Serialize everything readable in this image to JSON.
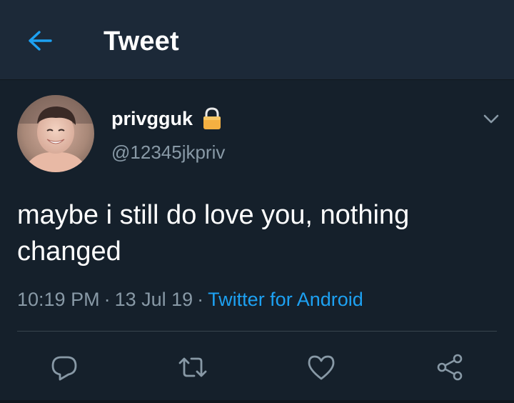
{
  "header": {
    "back_icon": "arrow-left-icon",
    "title": "Tweet"
  },
  "tweet": {
    "author": {
      "display_name": "privgguk",
      "handle": "@12345jkpriv",
      "protected_icon": "lock-icon",
      "avatar": "profile photo"
    },
    "text": "maybe i still do love you, nothing changed",
    "time": "10:19 PM",
    "separator": "·",
    "date": "13 Jul 19",
    "source": "Twitter for Android",
    "menu_icon": "chevron-down-icon"
  },
  "actions": [
    {
      "name": "reply",
      "icon": "reply-icon"
    },
    {
      "name": "retweet",
      "icon": "retweet-icon"
    },
    {
      "name": "like",
      "icon": "heart-icon"
    },
    {
      "name": "share",
      "icon": "share-icon"
    }
  ],
  "colors": {
    "background": "#15202b",
    "header": "#1c2938",
    "accent": "#1da1f2",
    "secondary_text": "#8899a6",
    "lock": "#f5b041"
  }
}
